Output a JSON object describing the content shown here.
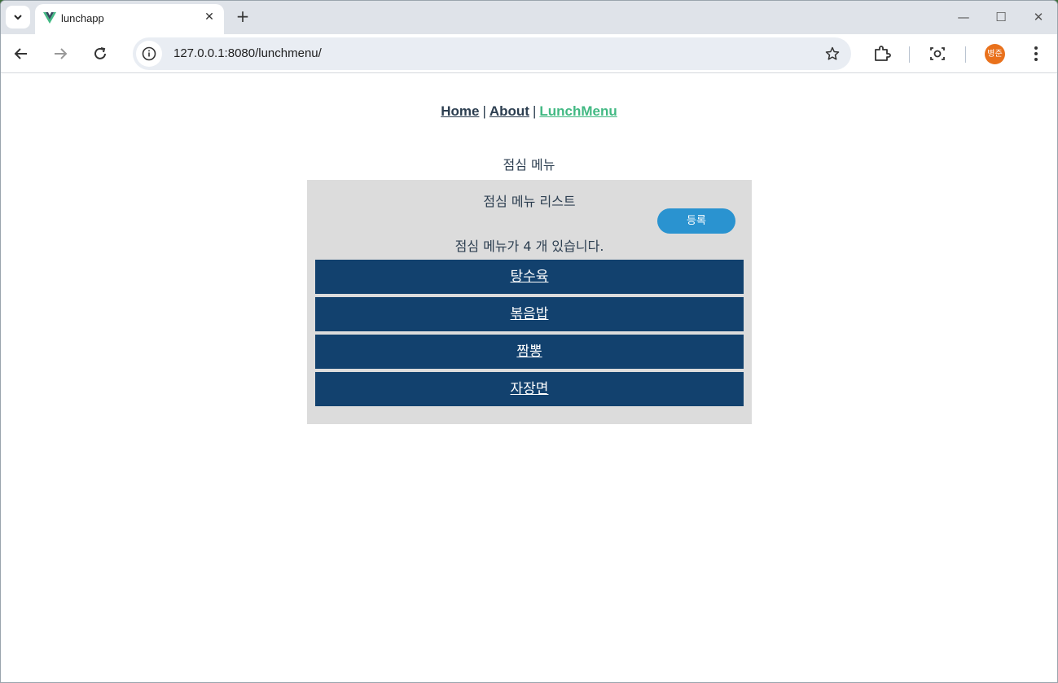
{
  "browser": {
    "tab_title": "lunchapp",
    "url": "127.0.0.1:8080/lunchmenu/",
    "profile_name": "병준",
    "colors": {
      "accent_avatar": "#e9711c",
      "tab_strip": "#dfe3e9"
    }
  },
  "nav": {
    "links": [
      "Home",
      "About",
      "LunchMenu"
    ],
    "separator": "|",
    "active": "LunchMenu"
  },
  "page": {
    "heading": "점심 메뉴",
    "panel_title": "점심 메뉴 리스트",
    "register_label": "등록",
    "count_text": "점심 메뉴가 4 개 있습니다.",
    "menu_items": [
      "탕수육",
      "볶음밥",
      "짬뽕",
      "자장면"
    ],
    "colors": {
      "panel_bg": "#dcdcdc",
      "item_bg": "#12416e",
      "button_bg": "#2a93d0",
      "nav_active": "#42b983",
      "text": "#2c3e50"
    }
  }
}
